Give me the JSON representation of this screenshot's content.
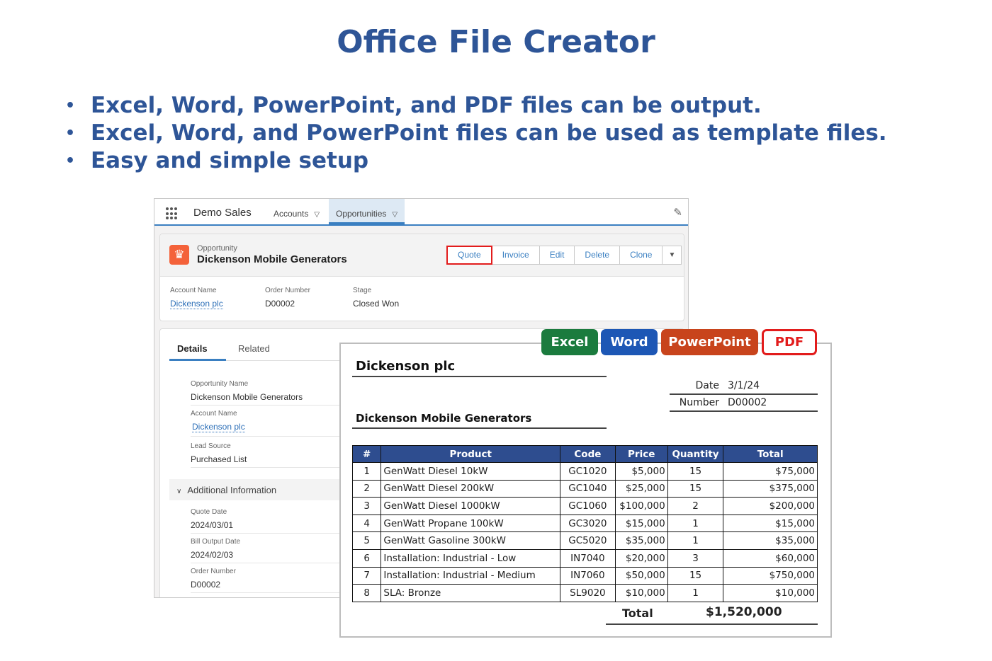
{
  "title": "Office File Creator",
  "bullets": [
    "Excel, Word, PowerPoint, and PDF files can be output.",
    "Excel, Word, and PowerPoint files can be used as template files.",
    "Easy and simple setup"
  ],
  "crm": {
    "app_name": "Demo Sales",
    "nav": [
      {
        "label": "Accounts"
      },
      {
        "label": "Opportunities"
      }
    ],
    "record": {
      "type": "Opportunity",
      "name": "Dickenson Mobile Generators",
      "actions": [
        "Quote",
        "Invoice",
        "Edit",
        "Delete",
        "Clone"
      ],
      "highlights": [
        {
          "label": "Account Name",
          "value": "Dickenson plc"
        },
        {
          "label": "Order Number",
          "value": "D00002"
        },
        {
          "label": "Stage",
          "value": "Closed Won"
        }
      ]
    },
    "tabs": [
      "Details",
      "Related"
    ],
    "details": [
      {
        "label": "Opportunity Name",
        "value": "Dickenson Mobile Generators"
      },
      {
        "label": "Account Name",
        "value": "Dickenson plc"
      },
      {
        "label": "Lead Source",
        "value": "Purchased List"
      }
    ],
    "section": "Additional Information",
    "additional": [
      {
        "label": "Quote Date",
        "value": "2024/03/01"
      },
      {
        "label": "Bill Output Date",
        "value": "2024/02/03"
      },
      {
        "label": "Order Number",
        "value": "D00002"
      }
    ]
  },
  "formats": [
    "Excel",
    "Word",
    "PowerPoint",
    "PDF"
  ],
  "colors": {
    "title": "#2e5597",
    "excel": "#1b7b3e",
    "word": "#1d57b5",
    "powerpoint": "#c8441c",
    "pdf": "#e21c1c",
    "table_header": "#2e4d8f"
  },
  "document": {
    "company": "Dickenson plc",
    "date_label": "Date",
    "date": "3/1/24",
    "number_label": "Number",
    "number": "D00002",
    "subject": "Dickenson Mobile Generators",
    "headers": [
      "#",
      "Product",
      "Code",
      "Price",
      "Quantity",
      "Total"
    ],
    "rows": [
      [
        "1",
        "GenWatt Diesel 10kW",
        "GC1020",
        "$5,000",
        "15",
        "$75,000"
      ],
      [
        "2",
        "GenWatt Diesel 200kW",
        "GC1040",
        "$25,000",
        "15",
        "$375,000"
      ],
      [
        "3",
        "GenWatt Diesel 1000kW",
        "GC1060",
        "$100,000",
        "2",
        "$200,000"
      ],
      [
        "4",
        "GenWatt Propane 100kW",
        "GC3020",
        "$15,000",
        "1",
        "$15,000"
      ],
      [
        "5",
        "GenWatt Gasoline 300kW",
        "GC5020",
        "$35,000",
        "1",
        "$35,000"
      ],
      [
        "6",
        "Installation: Industrial - Low",
        "IN7040",
        "$20,000",
        "3",
        "$60,000"
      ],
      [
        "7",
        "Installation: Industrial - Medium",
        "IN7060",
        "$50,000",
        "15",
        "$750,000"
      ],
      [
        "8",
        "SLA: Bronze",
        "SL9020",
        "$10,000",
        "1",
        "$10,000"
      ]
    ],
    "total_label": "Total",
    "total_value": "$1,520,000"
  }
}
